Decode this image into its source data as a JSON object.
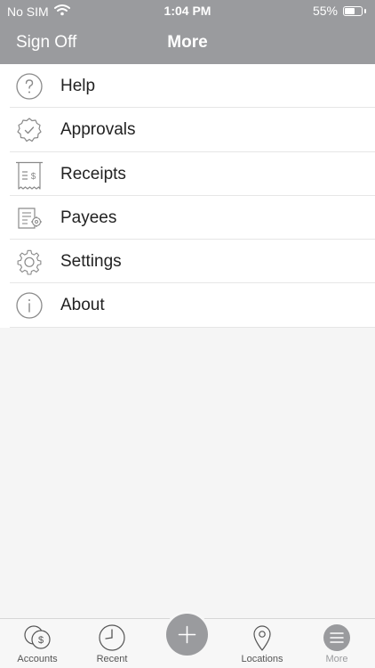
{
  "status_bar": {
    "carrier": "No SIM",
    "time": "1:04 PM",
    "battery": "55%",
    "battery_level": 0.55
  },
  "nav": {
    "left_button": "Sign Off",
    "title": "More"
  },
  "menu": {
    "items": [
      {
        "label": "Help",
        "icon": "help-icon"
      },
      {
        "label": "Approvals",
        "icon": "approvals-badge-icon"
      },
      {
        "label": "Receipts",
        "icon": "receipt-icon"
      },
      {
        "label": "Payees",
        "icon": "payees-icon"
      },
      {
        "label": "Settings",
        "icon": "gear-icon"
      },
      {
        "label": "About",
        "icon": "info-icon"
      }
    ]
  },
  "tabbar": {
    "tabs": [
      {
        "label": "Accounts",
        "icon": "accounts-icon"
      },
      {
        "label": "Recent",
        "icon": "clock-icon"
      },
      {
        "label": "Locations",
        "icon": "location-pin-icon"
      },
      {
        "label": "More",
        "icon": "menu-icon",
        "active": true
      }
    ],
    "fab_icon": "plus-icon"
  },
  "colors": {
    "header_bg": "#9a9b9e",
    "list_bg": "#ffffff",
    "page_bg": "#f5f5f5",
    "icon_stroke": "#8a8a8a",
    "text": "#222222"
  }
}
